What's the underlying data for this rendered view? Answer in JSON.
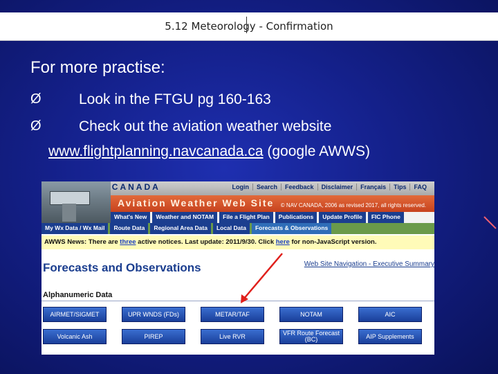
{
  "slide": {
    "title": "5.12 Meteorology - Confirmation",
    "heading": "For more practise:",
    "bullets": [
      {
        "arrow": "Ø",
        "text": "Look in the FTGU pg 160-163"
      },
      {
        "arrow": "Ø",
        "text": "Check out the aviation weather website"
      }
    ],
    "link_text": "www.flightplanning.navcanada.ca",
    "link_suffix": " (google AWWS)"
  },
  "website": {
    "brand": "NAV CANADA",
    "top_links": [
      "Login",
      "Search",
      "Feedback",
      "Disclaimer",
      "Français",
      "Tips",
      "FAQ"
    ],
    "banner_title": "Aviation Weather Web Site",
    "copyright": "© NAV CANADA, 2006 as revised 2017, all rights reserved.",
    "menu": [
      "What's New",
      "Weather and NOTAM",
      "File a Flight Plan",
      "Publications",
      "Update Profile",
      "FIC Phone"
    ],
    "tabs": [
      "My Wx Data / Wx Mail",
      "Route Data",
      "Regional Area Data",
      "Local Data",
      "Forecasts & Observations"
    ],
    "news": {
      "prefix": "AWWS News: There are ",
      "count": "three",
      "middle": " active notices. Last update: 2011/9/30. Click ",
      "here": "here",
      "suffix": " for non-JavaScript version."
    },
    "section_title": "Forecasts and Observations",
    "nav_link": "Web Site Navigation - Executive Summary",
    "subsection": "Alphanumeric Data",
    "buttons_row1": [
      "AIRMET/SIGMET",
      "UPR WNDS (FDs)",
      "METAR/TAF",
      "NOTAM",
      "AIC"
    ],
    "buttons_row2": [
      "Volcanic Ash",
      "PIREP",
      "Live RVR",
      "VFR Route Forecast (BC)",
      "AIP Supplements"
    ]
  },
  "colors": {
    "background": "#14208a",
    "banner": "#d2522a",
    "nav_button": "#1b3e8f",
    "annotation_arrow": "#e0201c"
  }
}
